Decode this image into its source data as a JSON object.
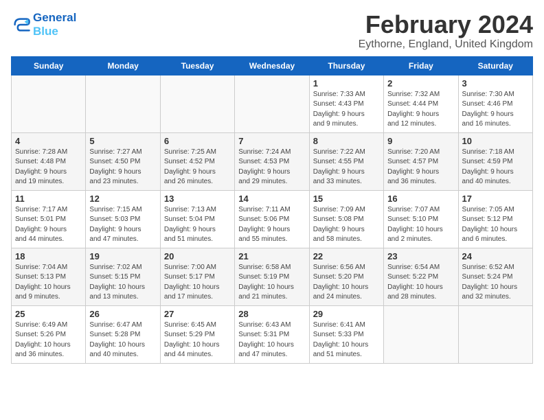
{
  "logo": {
    "line1": "General",
    "line2": "Blue"
  },
  "title": "February 2024",
  "subtitle": "Eythorne, England, United Kingdom",
  "days_of_week": [
    "Sunday",
    "Monday",
    "Tuesday",
    "Wednesday",
    "Thursday",
    "Friday",
    "Saturday"
  ],
  "weeks": [
    [
      {
        "day": "",
        "info": ""
      },
      {
        "day": "",
        "info": ""
      },
      {
        "day": "",
        "info": ""
      },
      {
        "day": "",
        "info": ""
      },
      {
        "day": "1",
        "info": "Sunrise: 7:33 AM\nSunset: 4:43 PM\nDaylight: 9 hours\nand 9 minutes."
      },
      {
        "day": "2",
        "info": "Sunrise: 7:32 AM\nSunset: 4:44 PM\nDaylight: 9 hours\nand 12 minutes."
      },
      {
        "day": "3",
        "info": "Sunrise: 7:30 AM\nSunset: 4:46 PM\nDaylight: 9 hours\nand 16 minutes."
      }
    ],
    [
      {
        "day": "4",
        "info": "Sunrise: 7:28 AM\nSunset: 4:48 PM\nDaylight: 9 hours\nand 19 minutes."
      },
      {
        "day": "5",
        "info": "Sunrise: 7:27 AM\nSunset: 4:50 PM\nDaylight: 9 hours\nand 23 minutes."
      },
      {
        "day": "6",
        "info": "Sunrise: 7:25 AM\nSunset: 4:52 PM\nDaylight: 9 hours\nand 26 minutes."
      },
      {
        "day": "7",
        "info": "Sunrise: 7:24 AM\nSunset: 4:53 PM\nDaylight: 9 hours\nand 29 minutes."
      },
      {
        "day": "8",
        "info": "Sunrise: 7:22 AM\nSunset: 4:55 PM\nDaylight: 9 hours\nand 33 minutes."
      },
      {
        "day": "9",
        "info": "Sunrise: 7:20 AM\nSunset: 4:57 PM\nDaylight: 9 hours\nand 36 minutes."
      },
      {
        "day": "10",
        "info": "Sunrise: 7:18 AM\nSunset: 4:59 PM\nDaylight: 9 hours\nand 40 minutes."
      }
    ],
    [
      {
        "day": "11",
        "info": "Sunrise: 7:17 AM\nSunset: 5:01 PM\nDaylight: 9 hours\nand 44 minutes."
      },
      {
        "day": "12",
        "info": "Sunrise: 7:15 AM\nSunset: 5:03 PM\nDaylight: 9 hours\nand 47 minutes."
      },
      {
        "day": "13",
        "info": "Sunrise: 7:13 AM\nSunset: 5:04 PM\nDaylight: 9 hours\nand 51 minutes."
      },
      {
        "day": "14",
        "info": "Sunrise: 7:11 AM\nSunset: 5:06 PM\nDaylight: 9 hours\nand 55 minutes."
      },
      {
        "day": "15",
        "info": "Sunrise: 7:09 AM\nSunset: 5:08 PM\nDaylight: 9 hours\nand 58 minutes."
      },
      {
        "day": "16",
        "info": "Sunrise: 7:07 AM\nSunset: 5:10 PM\nDaylight: 10 hours\nand 2 minutes."
      },
      {
        "day": "17",
        "info": "Sunrise: 7:05 AM\nSunset: 5:12 PM\nDaylight: 10 hours\nand 6 minutes."
      }
    ],
    [
      {
        "day": "18",
        "info": "Sunrise: 7:04 AM\nSunset: 5:13 PM\nDaylight: 10 hours\nand 9 minutes."
      },
      {
        "day": "19",
        "info": "Sunrise: 7:02 AM\nSunset: 5:15 PM\nDaylight: 10 hours\nand 13 minutes."
      },
      {
        "day": "20",
        "info": "Sunrise: 7:00 AM\nSunset: 5:17 PM\nDaylight: 10 hours\nand 17 minutes."
      },
      {
        "day": "21",
        "info": "Sunrise: 6:58 AM\nSunset: 5:19 PM\nDaylight: 10 hours\nand 21 minutes."
      },
      {
        "day": "22",
        "info": "Sunrise: 6:56 AM\nSunset: 5:20 PM\nDaylight: 10 hours\nand 24 minutes."
      },
      {
        "day": "23",
        "info": "Sunrise: 6:54 AM\nSunset: 5:22 PM\nDaylight: 10 hours\nand 28 minutes."
      },
      {
        "day": "24",
        "info": "Sunrise: 6:52 AM\nSunset: 5:24 PM\nDaylight: 10 hours\nand 32 minutes."
      }
    ],
    [
      {
        "day": "25",
        "info": "Sunrise: 6:49 AM\nSunset: 5:26 PM\nDaylight: 10 hours\nand 36 minutes."
      },
      {
        "day": "26",
        "info": "Sunrise: 6:47 AM\nSunset: 5:28 PM\nDaylight: 10 hours\nand 40 minutes."
      },
      {
        "day": "27",
        "info": "Sunrise: 6:45 AM\nSunset: 5:29 PM\nDaylight: 10 hours\nand 44 minutes."
      },
      {
        "day": "28",
        "info": "Sunrise: 6:43 AM\nSunset: 5:31 PM\nDaylight: 10 hours\nand 47 minutes."
      },
      {
        "day": "29",
        "info": "Sunrise: 6:41 AM\nSunset: 5:33 PM\nDaylight: 10 hours\nand 51 minutes."
      },
      {
        "day": "",
        "info": ""
      },
      {
        "day": "",
        "info": ""
      }
    ]
  ]
}
